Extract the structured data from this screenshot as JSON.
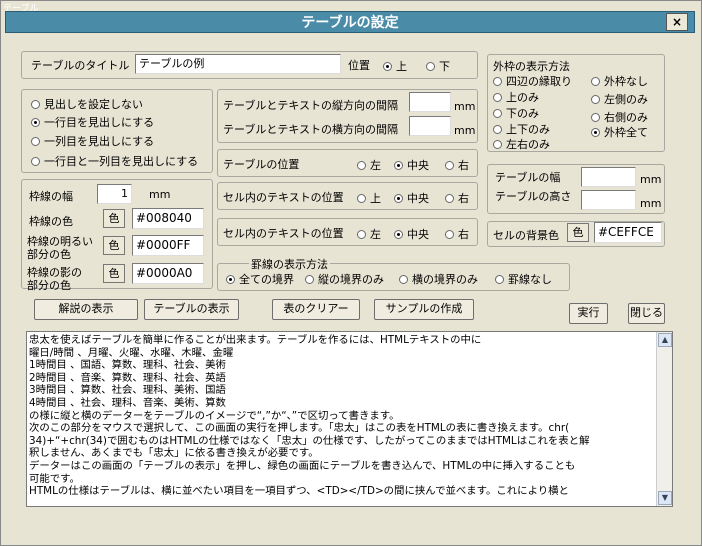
{
  "window": {
    "ghost_title": "テーブル",
    "title": "テーブルの設定",
    "close_label": "×"
  },
  "title_row": {
    "label": "テーブルのタイトル",
    "value": "テーブルの例",
    "position_label": "位置",
    "opt_top": "上",
    "opt_bottom": "下"
  },
  "heading": {
    "opt1": "見出しを設定しない",
    "opt2": "一行目を見出しにする",
    "opt3": "一列目を見出しにする",
    "opt4": "一行目と一列目を見出しにする"
  },
  "spacing": {
    "vertical_label": "テーブルとテキストの縦方向の間隔",
    "vertical_unit": "mm",
    "horizontal_label": "テーブルとテキストの横方向の間隔",
    "horizontal_unit": "mm"
  },
  "table_pos": {
    "label": "テーブルの位置",
    "left": "左",
    "center": "中央",
    "right": "右"
  },
  "cell_vpos": {
    "label": "セル内のテキストの位置",
    "top": "上",
    "center": "中央",
    "bottom": "右"
  },
  "cell_hpos": {
    "label": "セル内のテキストの位置",
    "left": "左",
    "center": "中央",
    "right": "右"
  },
  "border": {
    "width_label": "枠線の幅",
    "width_value": "1",
    "width_unit": "mm",
    "color_label": "枠線の色",
    "color_btn": "色",
    "color_value": "#008040",
    "light_label1": "枠線の明るい",
    "light_label2": "部分の色",
    "light_btn": "色",
    "light_value": "#0000FF",
    "shadow_label1": "枠線の影の",
    "shadow_label2": "部分の色",
    "shadow_btn": "色",
    "shadow_value": "#0000A0"
  },
  "grid": {
    "label": "罫線の表示方法",
    "all": "全ての境界",
    "vertical": "縦の境界のみ",
    "horizontal": "横の境界のみ",
    "none": "罫線なし"
  },
  "outer": {
    "label": "外枠の表示方法",
    "o1": "四辺の縁取り",
    "o2": "外枠なし",
    "o3": "上のみ",
    "o4": "左側のみ",
    "o5": "下のみ",
    "o6": "右側のみ",
    "o7": "上下のみ",
    "o8": "外枠全て",
    "o9": "左右のみ"
  },
  "size": {
    "width_label": "テーブルの幅",
    "width_unit": "mm",
    "height_label": "テーブルの高さ",
    "height_unit": "mm"
  },
  "bgcolor": {
    "label": "セルの背景色",
    "btn": "色",
    "value": "#CEFFCE"
  },
  "buttons": {
    "explain": "解説の表示",
    "show_table": "テーブルの表示",
    "clear": "表のクリアー",
    "sample": "サンプルの作成",
    "run": "実行",
    "close": "閉じる"
  },
  "memo_lines": [
    "忠太を使えばテーブルを簡単に作ることが出来ます。テーブルを作るには、HTMLテキストの中に",
    "曜日/時間 、月曜、火曜、水曜、木曜、金曜",
    "1時間目 、国語、算数、理科、社会、美術",
    "2時間目 、音楽、算数、理科、社会、英語",
    "3時間目 、算数、社会、理科、美術、国語",
    "4時間目 、社会、理科、音楽、美術、算数",
    "の様に縦と横のデーターをテーブルのイメージで“,”か“、”で区切って書きます。",
    "次のこの部分をマウスで選択して、この画面の実行を押します。「忠太」はこの表をHTMLの表に書き換えます。chr(",
    "34)+“+chr(34)で囲むものはHTMLの仕様ではなく「忠太」の仕様です、したがってこのままではHTMLはこれを表と解",
    "釈しません、あくまでも「忠太」に依る書き換えが必要です。",
    "データーはこの画面の「テーブルの表示」を押し、緑色の画面にテーブルを書き込んで、HTMLの中に挿入することも",
    "可能です。",
    "HTMLの仕様はテーブルは、横に並べたい項目を一項目ずつ、<TD></TD>の間に挟んで並べます。これにより横と"
  ]
}
